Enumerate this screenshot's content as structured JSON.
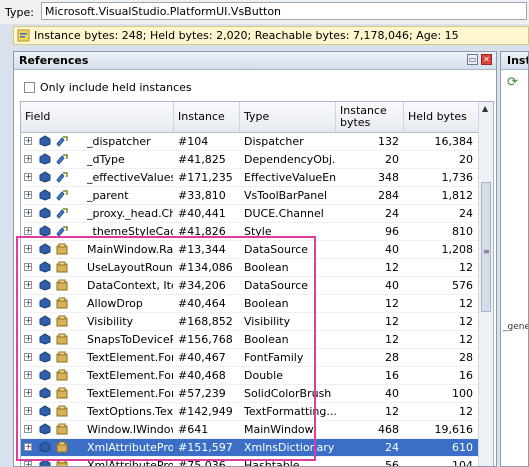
{
  "type_bar": {
    "label": "Type:",
    "value": "Microsoft.VisualStudio.PlatformUI.VsButton"
  },
  "info_bar": {
    "text": "Instance bytes: 248; Held bytes: 2,020; Reachable bytes: 7,178,046; Age: 15"
  },
  "references": {
    "title": "References",
    "checkbox_label": "Only include held instances",
    "columns": {
      "field": "Field",
      "instance": "Instance",
      "type": "Type",
      "instance_bytes": "Instance bytes",
      "held_bytes": "Held bytes"
    },
    "rows": [
      {
        "field": "_dispatcher",
        "instance": "#104",
        "type": "Dispatcher",
        "ib": "132",
        "hb": "16,384"
      },
      {
        "field": "_dType",
        "instance": "#41,825",
        "type": "DependencyObj...",
        "ib": "20",
        "hb": "20"
      },
      {
        "field": "_effectiveValues",
        "instance": "#171,235",
        "type": "EffectiveValueEn...",
        "ib": "348",
        "hb": "1,736"
      },
      {
        "field": "_parent",
        "instance": "#33,810",
        "type": "VsToolBarPanel",
        "ib": "284",
        "hb": "1,812"
      },
      {
        "field": "_proxy._head.Cha...",
        "instance": "#40,441",
        "type": "DUCE.Channel",
        "ib": "24",
        "hb": "24"
      },
      {
        "field": "_themeStyleCache",
        "instance": "#41,826",
        "type": "Style",
        "ib": "96",
        "hb": "810"
      },
      {
        "field": "MainWindow.Raw...",
        "instance": "#13,344",
        "type": "DataSource",
        "ib": "40",
        "hb": "1,208"
      },
      {
        "field": "UseLayoutRounding",
        "instance": "#134,086",
        "type": "Boolean",
        "ib": "12",
        "hb": "12"
      },
      {
        "field": "DataContext, Item...",
        "instance": "#34,206",
        "type": "DataSource",
        "ib": "40",
        "hb": "576"
      },
      {
        "field": "AllowDrop",
        "instance": "#40,464",
        "type": "Boolean",
        "ib": "12",
        "hb": "12"
      },
      {
        "field": "Visibility",
        "instance": "#168,852",
        "type": "Visibility",
        "ib": "12",
        "hb": "12"
      },
      {
        "field": "SnapsToDevicePixels",
        "instance": "#156,768",
        "type": "Boolean",
        "ib": "12",
        "hb": "12"
      },
      {
        "field": "TextElement.Font...",
        "instance": "#40,467",
        "type": "FontFamily",
        "ib": "28",
        "hb": "28"
      },
      {
        "field": "TextElement.Font...",
        "instance": "#40,468",
        "type": "Double",
        "ib": "16",
        "hb": "16"
      },
      {
        "field": "TextElement.Fore...",
        "instance": "#57,239",
        "type": "SolidColorBrush",
        "ib": "40",
        "hb": "100"
      },
      {
        "field": "TextOptions.TextF...",
        "instance": "#142,949",
        "type": "TextFormatting...",
        "ib": "12",
        "hb": "12"
      },
      {
        "field": "Window.IWindowS...",
        "instance": "#641",
        "type": "MainWindow",
        "ib": "468",
        "hb": "19,616"
      },
      {
        "field": "XmlAttributeProper...",
        "instance": "#151,597",
        "type": "XmlnsDictionary",
        "ib": "24",
        "hb": "610",
        "selected": true
      },
      {
        "field": "XmlAttributeProper...",
        "instance": "#75,036",
        "type": "Hashtable",
        "ib": "56",
        "hb": "104"
      }
    ]
  },
  "right_panel": {
    "title": "Instances",
    "fragment": "_gene"
  },
  "colors": {
    "selection": "#3b6fc7",
    "highlight_box": "#e03ca0",
    "info_bg": "#fdf7cf"
  },
  "icons": [
    "expand-icon",
    "object-icon",
    "reference-icon",
    "close-icon",
    "maximize-icon",
    "refresh-icon",
    "info-icon"
  ]
}
